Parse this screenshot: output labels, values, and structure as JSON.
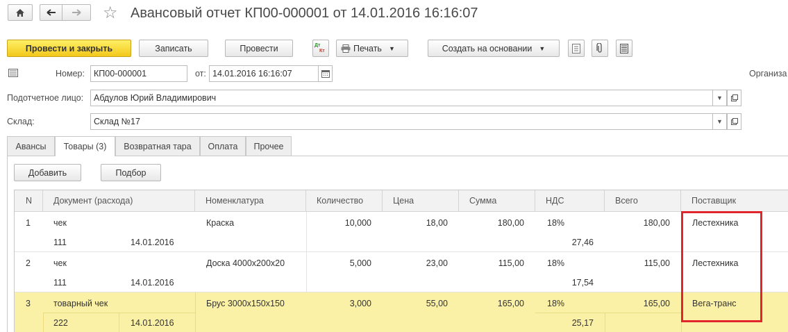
{
  "window": {
    "title": "Авансовый отчет КП00-000001 от 14.01.2016 16:16:07"
  },
  "toolbar": {
    "post_close": "Провести и закрыть",
    "save": "Записать",
    "post": "Провести",
    "print": "Печать",
    "create_based": "Создать на основании",
    "dtkt_top": "Дт",
    "dtkt_bottom": "Кт"
  },
  "form": {
    "number_label": "Номер:",
    "number_value": "КП00-000001",
    "date_label": "от:",
    "date_value": "14.01.2016 16:16:07",
    "org_label": "Организа",
    "person_label": "Подотчетное лицо:",
    "person_value": "Абдулов Юрий Владимирович",
    "warehouse_label": "Склад:",
    "warehouse_value": "Склад №17"
  },
  "tabs": [
    "Авансы",
    "Товары (3)",
    "Возвратная тара",
    "Оплата",
    "Прочее"
  ],
  "table_toolbar": {
    "add": "Добавить",
    "pick": "Подбор"
  },
  "table": {
    "headers": [
      "N",
      "Документ (расхода)",
      "Номенклатура",
      "Количество",
      "Цена",
      "Сумма",
      "НДС",
      "Всего",
      "Поставщик"
    ],
    "rows": [
      {
        "n": "1",
        "doc_type": "чек",
        "doc_num": "111",
        "doc_date": "14.01.2016",
        "item": "Краска",
        "qty": "10,000",
        "price": "18,00",
        "sum": "180,00",
        "vat_rate": "18%",
        "vat_sum": "27,46",
        "total": "180,00",
        "supplier": "Лестехника"
      },
      {
        "n": "2",
        "doc_type": "чек",
        "doc_num": "111",
        "doc_date": "14.01.2016",
        "item": "Доска 4000х200х20",
        "qty": "5,000",
        "price": "23,00",
        "sum": "115,00",
        "vat_rate": "18%",
        "vat_sum": "17,54",
        "total": "115,00",
        "supplier": "Лестехника"
      },
      {
        "n": "3",
        "doc_type": "товарный чек",
        "doc_num": "222",
        "doc_date": "14.01.2016",
        "item": "Брус 3000х150х150",
        "qty": "3,000",
        "price": "55,00",
        "sum": "165,00",
        "vat_rate": "18%",
        "vat_sum": "25,17",
        "total": "165,00",
        "supplier": "Вега-транс"
      }
    ]
  },
  "colors": {
    "primary_button": "#f2c81b",
    "selected_row": "#fbf1a6",
    "highlight_box": "#e0262a"
  }
}
